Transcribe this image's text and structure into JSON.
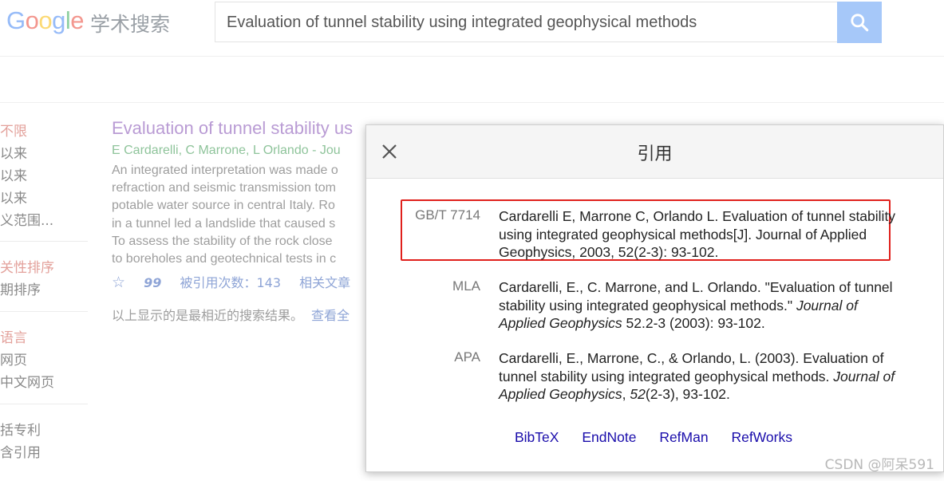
{
  "header": {
    "logo_text": "Google",
    "logo_sub": "学术搜索",
    "search_value": "Evaluation of tunnel stability using integrated geophysical methods",
    "search_icon": "search-icon"
  },
  "sidebar": {
    "time": [
      "不限",
      "以来",
      "以来",
      "以来",
      "义范围..."
    ],
    "sort": [
      "关性排序",
      "期排序"
    ],
    "lang": [
      "语言",
      "网页",
      "中文网页"
    ],
    "type": [
      "括专利",
      "含引用"
    ]
  },
  "result": {
    "title": "Evaluation of tunnel stability us",
    "authors": "E Cardarelli, C Marrone, L Orlando - Jou",
    "snippet": [
      "An integrated interpretation was made o",
      "refraction and seismic transmission tom",
      "potable water source in central Italy. Ro",
      "in a tunnel led a landslide that caused s",
      "To assess the stability of the rock close",
      "to boreholes and geotechnical tests in c"
    ],
    "actions": {
      "star_icon": "☆",
      "quote_icon": "99",
      "cited_by": "被引用次数：143",
      "related": "相关文章"
    },
    "notice": "以上显示的是最相近的搜索结果。",
    "notice_link": "查看全"
  },
  "modal": {
    "title": "引用",
    "close_icon": "close-icon",
    "citations": [
      {
        "style": "GB/T 7714",
        "text": "Cardarelli E, Marrone C, Orlando L. Evaluation of tunnel stability using integrated geophysical methods[J]. Journal of Applied Geophysics, 2003, 52(2-3): 93-102."
      },
      {
        "style": "MLA",
        "pre": "Cardarelli, E., C. Marrone, and L. Orlando. \"Evaluation of tunnel stability using integrated geophysical methods.\" ",
        "journal": "Journal of Applied Geophysics",
        "post": " 52.2-3 (2003): 93-102."
      },
      {
        "style": "APA",
        "pre": "Cardarelli, E., Marrone, C., & Orlando, L. (2003). Evaluation of tunnel stability using integrated geophysical methods. ",
        "journal": "Journal of Applied Geophysics",
        "sep": ", ",
        "volume": "52",
        "post": "(2-3), 93-102."
      }
    ],
    "export_links": [
      "BibTeX",
      "EndNote",
      "RefMan",
      "RefWorks"
    ]
  },
  "watermark": "CSDN @阿呆591",
  "colors": {
    "highlight": "#e0201c",
    "link": "#1a0dab",
    "search_button": "#a6c8f9"
  }
}
